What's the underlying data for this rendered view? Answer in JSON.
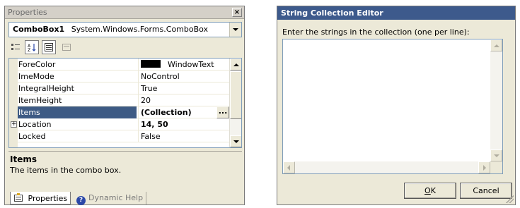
{
  "properties_window": {
    "title": "Properties",
    "close_glyph": "×",
    "object_selector": {
      "name": "ComboBox1",
      "type": "System.Windows.Forms.ComboBox"
    },
    "toolbar": [
      "categorized-icon",
      "alphabetical-icon",
      "properties-icon",
      "property-pages-icon"
    ],
    "grid_rows": [
      {
        "name": "ForeColor",
        "value": "WindowText",
        "swatch": "#000000"
      },
      {
        "name": "ImeMode",
        "value": "NoControl"
      },
      {
        "name": "IntegralHeight",
        "value": "True"
      },
      {
        "name": "ItemHeight",
        "value": "20"
      },
      {
        "name": "Items",
        "value": "(Collection)",
        "selected": true,
        "bold": true,
        "ellipsis": "..."
      },
      {
        "name": "Location",
        "value": "14, 50",
        "bold": true,
        "expander": "+"
      },
      {
        "name": "Locked",
        "value": "False"
      }
    ],
    "description": {
      "title": "Items",
      "text": "The items in the combo box."
    },
    "tabs": [
      {
        "label": "Properties",
        "icon": "properties-icon",
        "active": true
      },
      {
        "label": "Dynamic Help",
        "icon": "help-icon",
        "active": false
      }
    ],
    "colors": {
      "selected_row": "#3d5a84"
    }
  },
  "string_editor": {
    "title": "String Collection Editor",
    "prompt": "Enter the strings in the collection (one per line):",
    "text_value": "",
    "ok_accel": "O",
    "ok_rest": "K",
    "cancel_label": "Cancel",
    "colors": {
      "titlebar": "#3d5a8c"
    }
  }
}
